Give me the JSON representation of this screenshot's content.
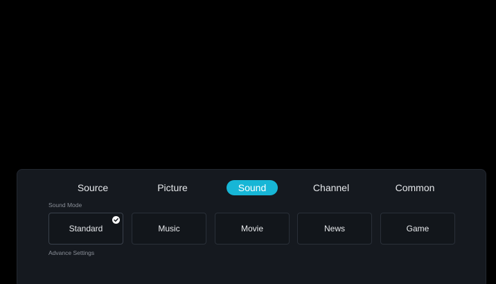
{
  "menu": {
    "tabs": [
      {
        "label": "Source"
      },
      {
        "label": "Picture"
      },
      {
        "label": "Sound"
      },
      {
        "label": "Channel"
      },
      {
        "label": "Common"
      }
    ],
    "active_tab": "Sound"
  },
  "sound_mode": {
    "label": "Sound Mode",
    "options": [
      {
        "label": "Standard"
      },
      {
        "label": "Music"
      },
      {
        "label": "Movie"
      },
      {
        "label": "News"
      },
      {
        "label": "Game"
      }
    ],
    "selected": "Standard",
    "selected_icon": "checkmark-icon"
  },
  "advance_settings": {
    "label": "Advance Settings"
  },
  "colors": {
    "accent": "#17b6d6",
    "panel": "#15191f"
  }
}
